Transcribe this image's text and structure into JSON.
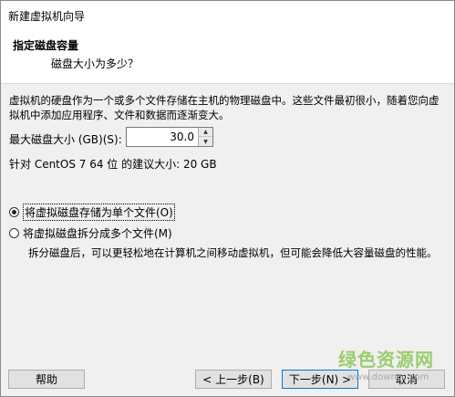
{
  "window": {
    "title": "新建虚拟机向导"
  },
  "header": {
    "title": "指定磁盘容量",
    "subtitle": "磁盘大小为多少？"
  },
  "content": {
    "description": "虚拟机的硬盘作为一个或多个文件存储在主机的物理磁盘中。这些文件最初很小，随着您向虚拟机中添加应用程序、文件和数据而逐渐变大。",
    "max_size_label": "最大磁盘大小 (GB)(S):",
    "max_size_value": "30.0",
    "recommended": "针对 CentOS 7 64 位 的建议大小: 20 GB",
    "options": [
      {
        "label": "将虚拟磁盘存储为单个文件(O)",
        "selected": true
      },
      {
        "label": "将虚拟磁盘拆分成多个文件(M)",
        "selected": false
      }
    ],
    "split_description": "拆分磁盘后，可以更轻松地在计算机之间移动虚拟机，但可能会降低大容量磁盘的性能。"
  },
  "footer": {
    "help": "帮助",
    "back": "< 上一步(B)",
    "next": "下一步(N) >",
    "cancel": "取消"
  },
  "watermark": {
    "line1": "绿色资源网",
    "line2": "www.downcc.com"
  },
  "colors": {
    "watermark_green": "#7dc242",
    "focus_border": "#0078d7"
  }
}
